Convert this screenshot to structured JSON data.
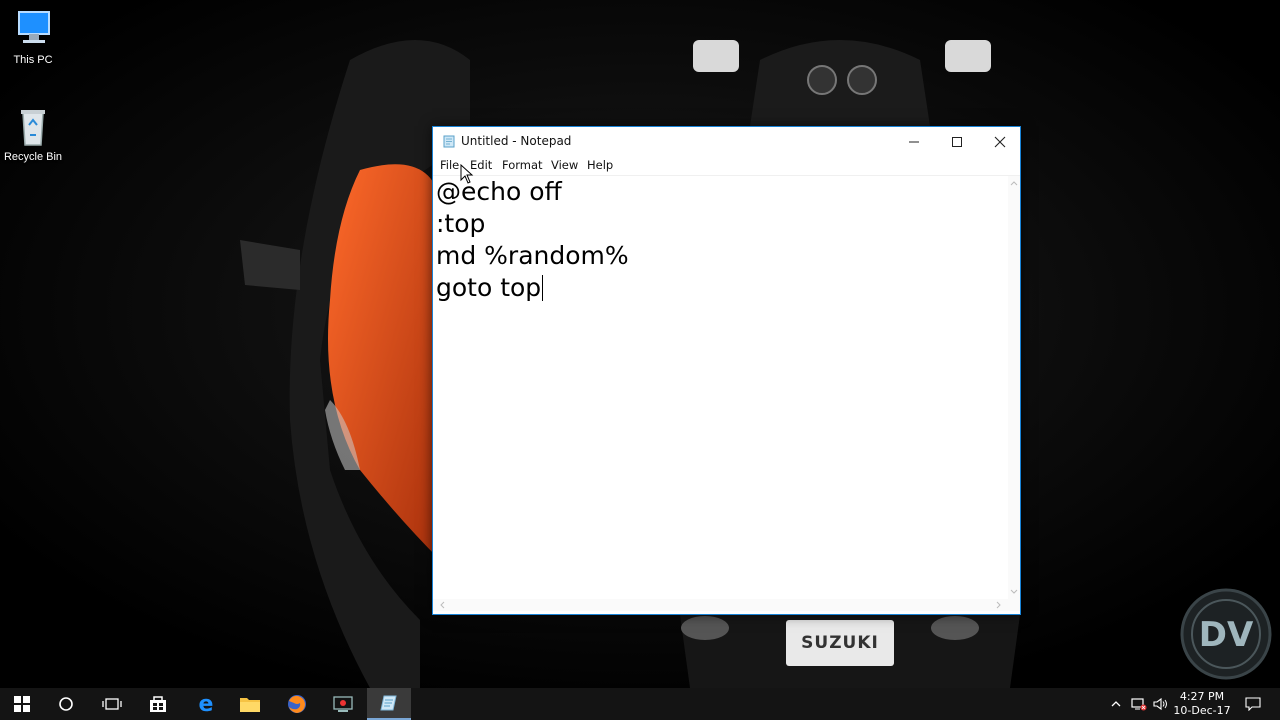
{
  "desktop": {
    "icons": [
      {
        "label": "This PC",
        "icon": "this-pc-icon"
      },
      {
        "label": "Recycle Bin",
        "icon": "recycle-bin-icon"
      }
    ],
    "wallpaper_brand": "SUZUKI"
  },
  "notepad": {
    "title": "Untitled - Notepad",
    "menu": [
      "File",
      "Edit",
      "Format",
      "View",
      "Help"
    ],
    "lines": [
      "@echo off",
      ":top",
      "md %random%",
      "goto top"
    ],
    "accent": "#1883d7"
  },
  "taskbar": {
    "apps": [
      "start-icon",
      "cortana-search-icon",
      "task-view-icon",
      "store-icon",
      "edge-icon",
      "file-explorer-icon",
      "firefox-icon",
      "media-app-icon",
      "notepad-icon"
    ],
    "tray": {
      "time": "4:27 PM",
      "date": "10-Dec-17"
    }
  },
  "watermark": {
    "letters": "DV"
  }
}
